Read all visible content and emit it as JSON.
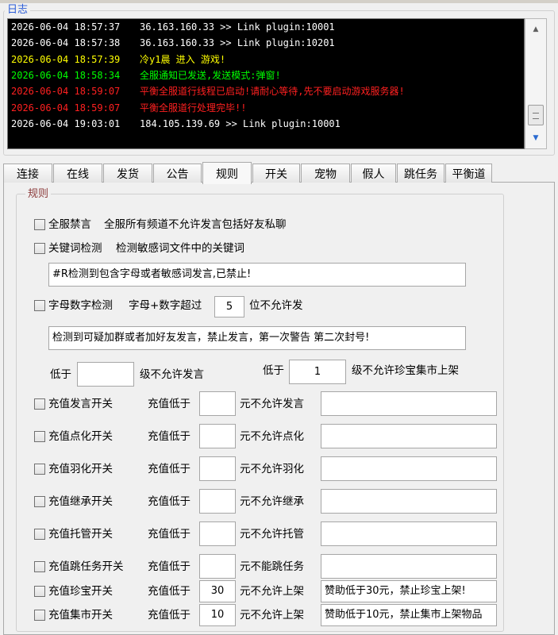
{
  "log": {
    "title": "日志",
    "lines": [
      {
        "time": "2026-06-04 18:57:37",
        "msg": "36.163.160.33 >> Link plugin:10001",
        "color": "#ffffff"
      },
      {
        "time": "2026-06-04 18:57:38",
        "msg": "36.163.160.33 >> Link plugin:10201",
        "color": "#ffffff"
      },
      {
        "time": "2026-06-04 18:57:39",
        "msg": "冷y1晨 进入 游戏!",
        "color": "#ffff00"
      },
      {
        "time": "2026-06-04 18:58:34",
        "msg": "全服通知已发送,发送模式:弹窗!",
        "color": "#00ff00"
      },
      {
        "time": "2026-06-04 18:59:07",
        "msg": "平衡全服道行线程已启动!请耐心等待,先不要启动游戏服务器!",
        "color": "#ff2020"
      },
      {
        "time": "2026-06-04 18:59:07",
        "msg": "平衡全服道行处理完毕!!",
        "color": "#ff2020"
      },
      {
        "time": "2026-06-04 19:03:01",
        "msg": "184.105.139.69 >> Link plugin:10001",
        "color": "#ffffff"
      }
    ]
  },
  "tabs": [
    "连接",
    "在线",
    "发货",
    "公告",
    "规则",
    "开关",
    "宠物",
    "假人",
    "跳任务",
    "平衡道"
  ],
  "active_tab": "规则",
  "rules": {
    "title": "规则",
    "ban_all": {
      "label": "全服禁言",
      "desc": "全服所有频道不允许发言包括好友私聊"
    },
    "keyword": {
      "label": "关键词检测",
      "desc": "检测敏感词文件中的关键词",
      "value": "#R检测到包含字母或者敏感词发言,已禁止!"
    },
    "alnum": {
      "label": "字母数字检测",
      "pre": "字母+数字超过",
      "count": "5",
      "post": "位不允许发",
      "value": "检测到可疑加群或者加好友发言，禁止发言，第一次警告 第二次封号!"
    },
    "level": {
      "pre1": "低于",
      "value1": "",
      "post1": "级不允许发言",
      "pre2": "低于",
      "value2": "1",
      "post2": "级不允许珍宝集市上架"
    },
    "recharge_prefix": "充值低于",
    "recharge": [
      {
        "label": "充值发言开关",
        "amount": "",
        "suffix": "元不允许发言",
        "message": ""
      },
      {
        "label": "充值点化开关",
        "amount": "",
        "suffix": "元不允许点化",
        "message": ""
      },
      {
        "label": "充值羽化开关",
        "amount": "",
        "suffix": "元不允许羽化",
        "message": ""
      },
      {
        "label": "充值继承开关",
        "amount": "",
        "suffix": "元不允许继承",
        "message": ""
      },
      {
        "label": "充值托管开关",
        "amount": "",
        "suffix": "元不允许托管",
        "message": ""
      },
      {
        "label": "充值跳任务开关",
        "amount": "",
        "suffix": "元不能跳任务",
        "message": ""
      },
      {
        "label": "充值珍宝开关",
        "amount": "30",
        "suffix": "元不允许上架",
        "message": "赞助低于30元，禁止珍宝上架!"
      },
      {
        "label": "充值集市开关",
        "amount": "10",
        "suffix": "元不允许上架",
        "message": "赞助低于10元，禁止集市上架物品"
      }
    ]
  }
}
